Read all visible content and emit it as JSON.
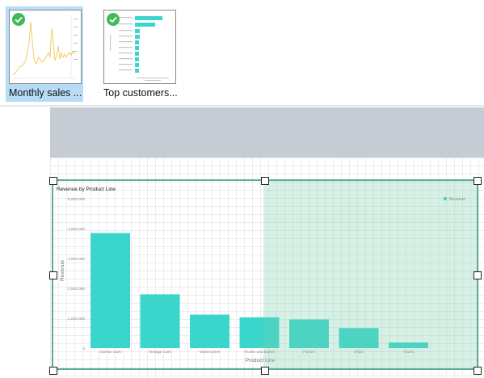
{
  "gallery": {
    "items": [
      {
        "label": "Monthly sales ...",
        "selected": true,
        "icon": "check-circle-icon"
      },
      {
        "label": "Top customers...",
        "selected": false,
        "icon": "check-circle-icon"
      }
    ]
  },
  "colors": {
    "accent": "#3ad6cc",
    "selection_fill": "#9fdcc8",
    "selection_border": "#5fae93",
    "check_green": "#3fba59",
    "thumb_selected_bg": "#b7dcf6",
    "line_yellow": "#f0c955"
  },
  "chart_data": {
    "type": "bar",
    "title": "Revenue by Product Line",
    "xlabel": "Product Line",
    "ylabel": "Revenue",
    "categories": [
      "Classic Cars",
      "Vintage Cars",
      "Motorcycles",
      "Trucks and Buses",
      "Planes",
      "Ships",
      "Trains"
    ],
    "values": [
      3850000,
      1800000,
      1120000,
      1030000,
      960000,
      670000,
      190000
    ],
    "series": [
      {
        "name": "Revenue",
        "values": [
          3850000,
          1800000,
          1120000,
          1030000,
          960000,
          670000,
          190000
        ]
      }
    ],
    "y_ticks": [
      "0",
      "1,000,000",
      "2,000,000",
      "3,000,000",
      "4,000,000",
      "5,000,000"
    ],
    "ylim": [
      0,
      5000000
    ],
    "legend_position": "top-right",
    "grid": false
  }
}
